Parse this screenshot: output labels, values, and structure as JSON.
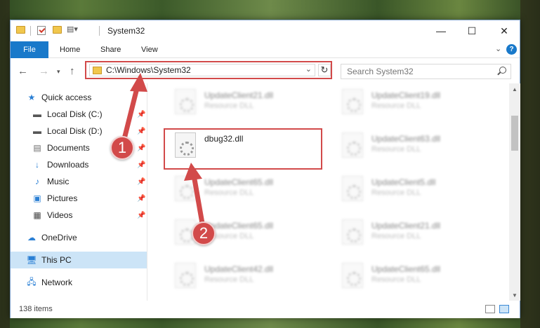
{
  "window": {
    "title": "System32",
    "controls": {
      "minimize": "—",
      "maximize": "☐",
      "close": "✕"
    }
  },
  "ribbon": {
    "tabs": [
      "File",
      "Home",
      "Share",
      "View"
    ]
  },
  "navigation": {
    "address": "C:\\Windows\\System32",
    "search_placeholder": "Search System32"
  },
  "sidebar": {
    "items": [
      {
        "label": "Quick access",
        "icon": "star-icon",
        "pinned": false
      },
      {
        "label": "Local Disk (C:)",
        "icon": "drive-icon",
        "pinned": true
      },
      {
        "label": "Local Disk (D:)",
        "icon": "drive-icon",
        "pinned": true
      },
      {
        "label": "Documents",
        "icon": "documents-icon",
        "pinned": true
      },
      {
        "label": "Downloads",
        "icon": "downloads-icon",
        "pinned": true
      },
      {
        "label": "Music",
        "icon": "music-icon",
        "pinned": true
      },
      {
        "label": "Pictures",
        "icon": "pictures-icon",
        "pinned": true
      },
      {
        "label": "Videos",
        "icon": "videos-icon",
        "pinned": true
      },
      {
        "label": "OneDrive",
        "icon": "onedrive-icon",
        "pinned": false
      },
      {
        "label": "This PC",
        "icon": "pc-icon",
        "pinned": false,
        "selected": true
      },
      {
        "label": "Network",
        "icon": "network-icon",
        "pinned": false
      }
    ]
  },
  "files": [
    {
      "name": "UpdateClient21.dll",
      "type": "Resource DLL"
    },
    {
      "name": "UpdateClient19.dll",
      "type": "Resource DLL"
    },
    {
      "name": "dbug32.dll",
      "type": "",
      "highlighted": true
    },
    {
      "name": "UpdateClient63.dll",
      "type": "Resource DLL"
    },
    {
      "name": "UpdateClient65.dll",
      "type": "Resource DLL"
    },
    {
      "name": "UpdateClient5.dll",
      "type": "Resource DLL"
    },
    {
      "name": "UpdateClient65.dll",
      "type": "Resource DLL"
    },
    {
      "name": "UpdateClient21.dll",
      "type": "Resource DLL"
    },
    {
      "name": "UpdateClient42.dll",
      "type": "Resource DLL"
    },
    {
      "name": "UpdateClient65.dll",
      "type": "Resource DLL"
    }
  ],
  "status": {
    "item_count": "138 items"
  },
  "annotations": {
    "step1": "1",
    "step2": "2",
    "color": "#d24a4a"
  }
}
